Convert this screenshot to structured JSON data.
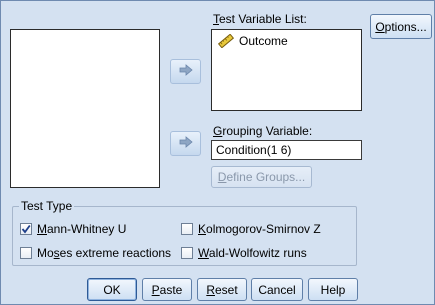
{
  "source_list": {
    "items": []
  },
  "test_variable_list": {
    "label_pre": "",
    "label_u": "T",
    "label_post": "est Variable List:",
    "items": [
      {
        "label": "Outcome",
        "icon": "ruler-icon"
      }
    ]
  },
  "grouping_variable": {
    "label_pre": "",
    "label_u": "G",
    "label_post": "rouping Variable:",
    "value": "Condition(1 6)"
  },
  "buttons": {
    "options": {
      "pre": "",
      "u": "O",
      "post": "ptions..."
    },
    "define_groups": {
      "pre": "",
      "u": "D",
      "post": "efine Groups..."
    },
    "ok": {
      "pre": "OK",
      "u": "",
      "post": ""
    },
    "paste": {
      "pre": "",
      "u": "P",
      "post": "aste"
    },
    "reset": {
      "pre": "",
      "u": "R",
      "post": "eset"
    },
    "cancel": {
      "pre": "Cancel",
      "u": "",
      "post": ""
    },
    "help": {
      "pre": "Help",
      "u": "",
      "post": ""
    }
  },
  "test_type": {
    "legend": "Test Type",
    "options": [
      {
        "pre": "",
        "u": "M",
        "post": "ann-Whitney U",
        "checked": true
      },
      {
        "pre": "",
        "u": "K",
        "post": "olmogorov-Smirnov Z",
        "checked": false
      },
      {
        "pre": "Mo",
        "u": "s",
        "post": "es extreme reactions",
        "checked": false
      },
      {
        "pre": "",
        "u": "W",
        "post": "ald-Wolfowitz runs",
        "checked": false
      }
    ]
  },
  "colors": {
    "background": "#d4e1f1",
    "accent": "#2e5a96",
    "check": "#1e3f8a"
  }
}
